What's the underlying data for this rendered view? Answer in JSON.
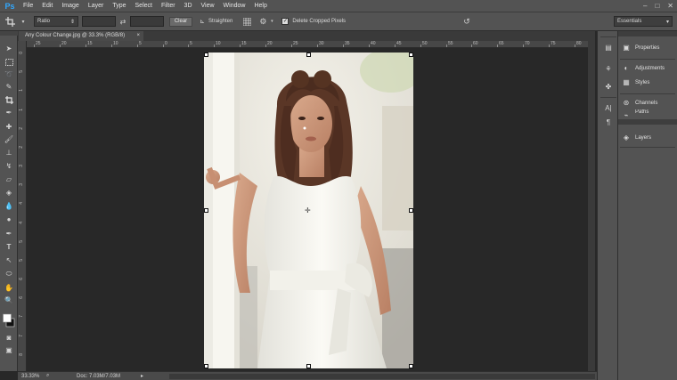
{
  "app": {
    "logo": "Ps"
  },
  "menu": [
    "File",
    "Edit",
    "Image",
    "Layer",
    "Type",
    "Select",
    "Filter",
    "3D",
    "View",
    "Window",
    "Help"
  ],
  "window_controls": {
    "minimize": "–",
    "maximize": "□",
    "close": "✕"
  },
  "options": {
    "ratio_select": "Ratio",
    "swap_icon": "⇄",
    "clear_button": "Clear",
    "straighten_icon": "⊾",
    "straighten_label": "Straighten",
    "delete_cropped_label": "Delete Cropped Pixels",
    "delete_cropped_checked": true,
    "workspace": "Essentials"
  },
  "document": {
    "tab_title": "Any Colour Change.jpg @ 33.3% (RGB/8)",
    "tab_close": "×",
    "zoom": "33.33%",
    "doc_info": "Doc: 7.03M/7.03M"
  },
  "rulers": {
    "top": [
      "25",
      "20",
      "15",
      "10",
      "5",
      "0",
      "5",
      "10",
      "15",
      "20",
      "25",
      "30",
      "35",
      "40",
      "45",
      "50",
      "55",
      "60",
      "65",
      "70",
      "75",
      "80"
    ],
    "left": [
      "0",
      "5",
      "1",
      "1",
      "2",
      "2",
      "3",
      "3",
      "4",
      "4",
      "5",
      "5",
      "6",
      "6",
      "7",
      "7",
      "8"
    ]
  },
  "panels": [
    {
      "label": "Properties",
      "icon": "properties-icon"
    },
    {
      "label": "Adjustments",
      "icon": "adjustments-icon"
    },
    {
      "label": "Styles",
      "icon": "styles-icon"
    },
    {
      "label": "Channels",
      "icon": "channels-icon"
    },
    {
      "label": "Paths",
      "icon": "paths-icon"
    },
    {
      "label": "Layers",
      "icon": "layers-icon"
    }
  ],
  "colors": {
    "ps_blue": "#31a8ff",
    "chrome": "#535353",
    "canvas_bg": "#282828"
  }
}
